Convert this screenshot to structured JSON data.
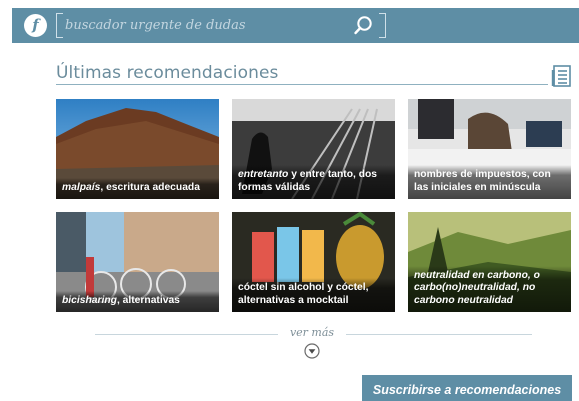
{
  "header": {
    "logo_letter": "f",
    "search_placeholder": "buscador urgente de dudas"
  },
  "section": {
    "title": "Últimas recomendaciones"
  },
  "cards": [
    {
      "caption_italic": "malpaís",
      "caption_rest": ", escritura adecuada"
    },
    {
      "caption_italic": "entretanto",
      "caption_rest": " y entre tanto, dos formas válidas"
    },
    {
      "caption_italic": "",
      "caption_rest": "nombres de impuestos, con las iniciales en minúscula"
    },
    {
      "caption_italic": "bicisharing",
      "caption_rest": ", alternativas"
    },
    {
      "caption_italic": "",
      "caption_rest": "cóctel sin alcohol y cóctel, alternativas a mocktail"
    },
    {
      "caption_italic": "neutralidad en carbono, o carbo(no)neutralidad, no carbono neutralidad",
      "caption_rest": ""
    }
  ],
  "more": {
    "label": "ver más"
  },
  "subscribe": {
    "label": "Suscribirse a recomendaciones"
  },
  "colors": {
    "brand": "#5e8ea5",
    "title": "#6b8c9c"
  },
  "icons": {
    "search": "search-icon",
    "feed": "rss-doc-icon",
    "more": "chevron-down-circle-icon"
  }
}
